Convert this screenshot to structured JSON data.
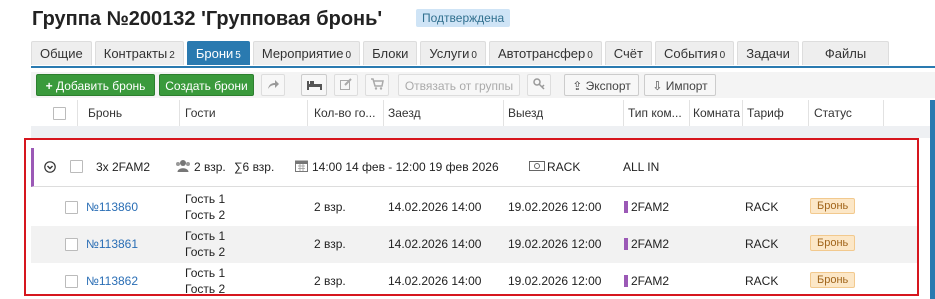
{
  "header": {
    "title": "Группа №200132 'Групповая бронь'",
    "status": "Подтверждена"
  },
  "tabs": [
    {
      "label": "Общие",
      "count": ""
    },
    {
      "label": "Контракты",
      "count": "2"
    },
    {
      "label": "Брони",
      "count": "5"
    },
    {
      "label": "Мероприятие",
      "count": "0"
    },
    {
      "label": "Блоки",
      "count": ""
    },
    {
      "label": "Услуги",
      "count": "0"
    },
    {
      "label": "Автотрансфер",
      "count": "0"
    },
    {
      "label": "Счёт",
      "count": ""
    },
    {
      "label": "События",
      "count": "0"
    },
    {
      "label": "Задачи",
      "count": ""
    },
    {
      "label": "Файлы",
      "count": ""
    }
  ],
  "toolbar": {
    "add": "Добавить бронь",
    "create": "Создать брони",
    "unlink": "Отвязать от группы",
    "export": "Экспорт",
    "import": "Импорт"
  },
  "columns": {
    "bron": "Бронь",
    "guests": "Гости",
    "count": "Кол-во го...",
    "checkin": "Заезд",
    "checkout": "Выезд",
    "roomtype": "Тип ком...",
    "room": "Комната",
    "tariff": "Тариф",
    "status": "Статус"
  },
  "group": {
    "name": "3х 2FAM2",
    "adults": "2 взр.",
    "total": "∑6 взр.",
    "dates": "14:00 14 фев - 12:00 19 фев 2026",
    "tariff": "RACK",
    "board": "ALL IN"
  },
  "rows": [
    {
      "id": "№113860",
      "guest1": "Гость 1",
      "guest2": "Гость 2",
      "count": "2 взр.",
      "checkin": "14.02.2026 14:00",
      "checkout": "19.02.2026 12:00",
      "roomtype": "2FAM2",
      "tariff": "RACK",
      "status": "Бронь"
    },
    {
      "id": "№113861",
      "guest1": "Гость 1",
      "guest2": "Гость 2",
      "count": "2 взр.",
      "checkin": "14.02.2026 14:00",
      "checkout": "19.02.2026 12:00",
      "roomtype": "2FAM2",
      "tariff": "RACK",
      "status": "Бронь"
    },
    {
      "id": "№113862",
      "guest1": "Гость 1",
      "guest2": "Гость 2",
      "count": "2 взр.",
      "checkin": "14.02.2026 14:00",
      "checkout": "19.02.2026 12:00",
      "roomtype": "2FAM2",
      "tariff": "RACK",
      "status": "Бронь"
    }
  ],
  "colors": {
    "accent": "#2a7ab0",
    "green": "#3a9a3c",
    "highlight": "#d6161e",
    "roomtype": "#9b59b6",
    "badge": "#fce7c7"
  }
}
